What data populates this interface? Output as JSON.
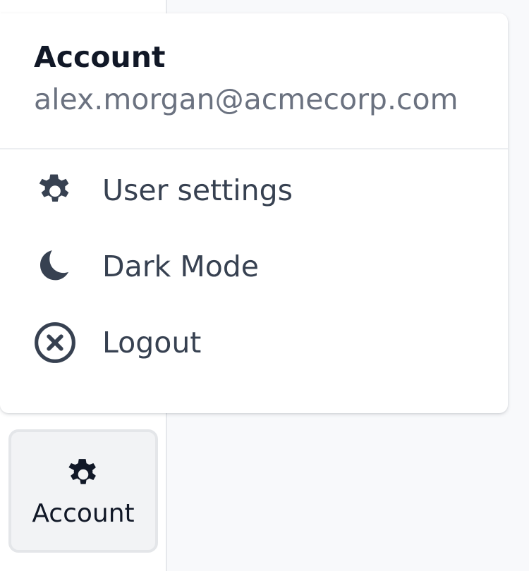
{
  "colors": {
    "menu_text": "#374151",
    "heading_text": "#111827",
    "muted_text": "#6b7280",
    "main_bg": "#f8f9fb",
    "button_bg": "#f2f3f5"
  },
  "account_menu": {
    "title": "Account",
    "email": "alex.morgan@acmecorp.com",
    "items": [
      {
        "label": "User settings",
        "icon": "gear-icon"
      },
      {
        "label": "Dark Mode",
        "icon": "moon-icon"
      },
      {
        "label": "Logout",
        "icon": "close-circle-icon"
      }
    ]
  },
  "sidebar": {
    "account_button": {
      "label": "Account",
      "icon": "gear-icon"
    }
  }
}
